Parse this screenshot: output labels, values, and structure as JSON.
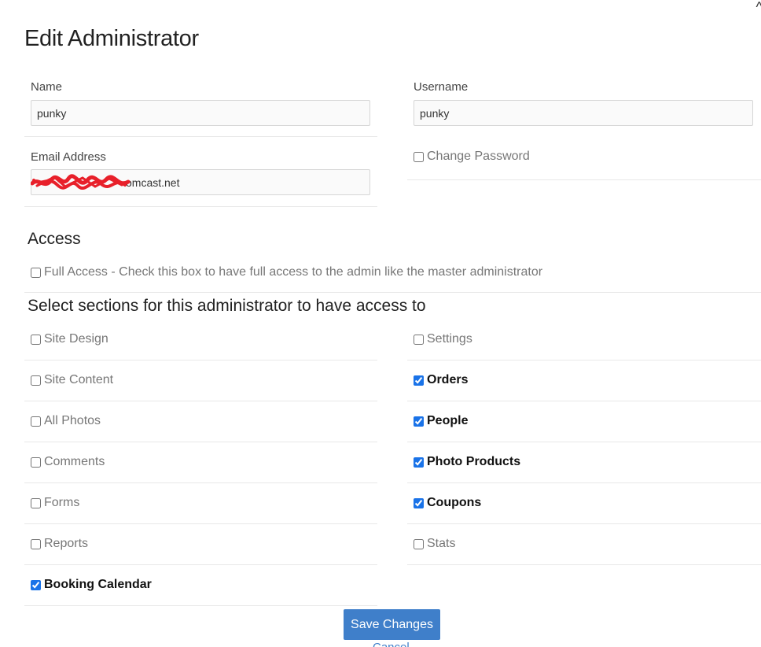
{
  "modal": {
    "title": "Edit Administrator",
    "close_glyph": "^"
  },
  "form": {
    "name_label": "Name",
    "name_value": "punky",
    "username_label": "Username",
    "username_value": "punky",
    "email_label": "Email Address",
    "email_value_visible": "omcast.net",
    "change_password_label": "Change Password",
    "change_password_checked": false
  },
  "access": {
    "heading": "Access",
    "full_access_label": "Full Access - Check this box to have full access to the admin like the master administrator",
    "full_access_checked": false,
    "sections_heading": "Select sections for this administrator to have access to",
    "left": [
      {
        "label": "Site Design",
        "checked": false
      },
      {
        "label": "Site Content",
        "checked": false
      },
      {
        "label": "All Photos",
        "checked": false
      },
      {
        "label": "Comments",
        "checked": false
      },
      {
        "label": "Forms",
        "checked": false
      },
      {
        "label": "Reports",
        "checked": false
      },
      {
        "label": "Booking Calendar",
        "checked": true
      }
    ],
    "right": [
      {
        "label": "Settings",
        "checked": false
      },
      {
        "label": "Orders",
        "checked": true
      },
      {
        "label": "People",
        "checked": true
      },
      {
        "label": "Photo Products",
        "checked": true
      },
      {
        "label": "Coupons",
        "checked": true
      },
      {
        "label": "Stats",
        "checked": false
      }
    ]
  },
  "actions": {
    "save_label": "Save Changes",
    "cancel_label": "Cancel"
  },
  "colors": {
    "primary_button": "#3f7fca",
    "redaction": "#e8202a"
  },
  "icons": {
    "close": "close-icon"
  }
}
